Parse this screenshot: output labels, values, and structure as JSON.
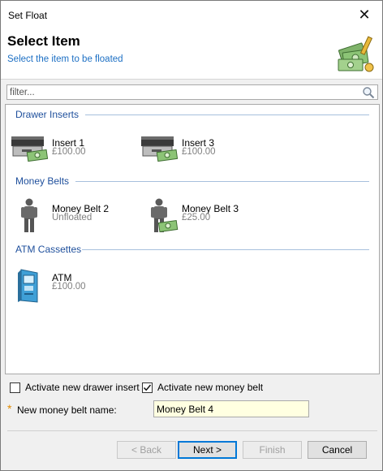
{
  "window": {
    "title": "Set Float",
    "close_glyph": "✕"
  },
  "header": {
    "title": "Select Item",
    "subtitle": "Select the item to be floated",
    "icon": "money-float-icon"
  },
  "filter": {
    "placeholder": "filter...",
    "value": ""
  },
  "groups": [
    {
      "label": "Drawer Inserts",
      "items": [
        {
          "name": "Insert 1",
          "value": "£100.00",
          "icon": "cash-drawer-icon"
        },
        {
          "name": "Insert 3",
          "value": "£100.00",
          "icon": "cash-drawer-icon"
        }
      ]
    },
    {
      "label": "Money Belts",
      "items": [
        {
          "name": "Money Belt 2",
          "value": "Unfloated",
          "icon": "person-icon"
        },
        {
          "name": "Money Belt 3",
          "value": "£25.00",
          "icon": "person-money-icon"
        }
      ]
    },
    {
      "label": "ATM Cassettes",
      "items": [
        {
          "name": "ATM",
          "value": "£100.00",
          "icon": "atm-icon"
        }
      ]
    }
  ],
  "options": {
    "activate_drawer_insert": {
      "label": "Activate new drawer insert",
      "checked": false
    },
    "activate_money_belt": {
      "label": "Activate new money belt",
      "checked": true
    }
  },
  "new_belt": {
    "required_marker": "*",
    "label": "New money belt name:",
    "value": "Money Belt 4"
  },
  "buttons": {
    "back": {
      "label": "< Back",
      "enabled": false
    },
    "next": {
      "label": "Next >",
      "enabled": true
    },
    "finish": {
      "label": "Finish",
      "enabled": false
    },
    "cancel": {
      "label": "Cancel",
      "enabled": true
    }
  },
  "colors": {
    "group_header": "#1e4f9c",
    "subtitle": "#1c6fc4",
    "value_text": "#808080",
    "required": "#e08a00",
    "input_highlight": "#ffffe1"
  }
}
